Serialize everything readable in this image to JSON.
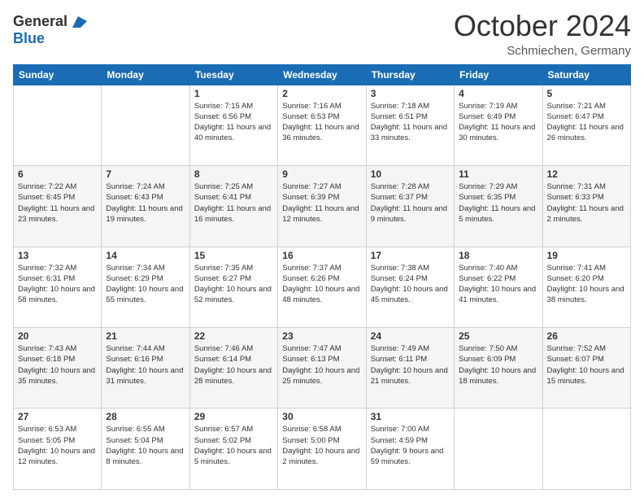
{
  "header": {
    "logo_general": "General",
    "logo_blue": "Blue",
    "month_title": "October 2024",
    "location": "Schmiechen, Germany"
  },
  "weekdays": [
    "Sunday",
    "Monday",
    "Tuesday",
    "Wednesday",
    "Thursday",
    "Friday",
    "Saturday"
  ],
  "weeks": [
    [
      {
        "day": "",
        "info": ""
      },
      {
        "day": "",
        "info": ""
      },
      {
        "day": "1",
        "info": "Sunrise: 7:15 AM\nSunset: 6:56 PM\nDaylight: 11 hours and 40 minutes."
      },
      {
        "day": "2",
        "info": "Sunrise: 7:16 AM\nSunset: 6:53 PM\nDaylight: 11 hours and 36 minutes."
      },
      {
        "day": "3",
        "info": "Sunrise: 7:18 AM\nSunset: 6:51 PM\nDaylight: 11 hours and 33 minutes."
      },
      {
        "day": "4",
        "info": "Sunrise: 7:19 AM\nSunset: 6:49 PM\nDaylight: 11 hours and 30 minutes."
      },
      {
        "day": "5",
        "info": "Sunrise: 7:21 AM\nSunset: 6:47 PM\nDaylight: 11 hours and 26 minutes."
      }
    ],
    [
      {
        "day": "6",
        "info": "Sunrise: 7:22 AM\nSunset: 6:45 PM\nDaylight: 11 hours and 23 minutes."
      },
      {
        "day": "7",
        "info": "Sunrise: 7:24 AM\nSunset: 6:43 PM\nDaylight: 11 hours and 19 minutes."
      },
      {
        "day": "8",
        "info": "Sunrise: 7:25 AM\nSunset: 6:41 PM\nDaylight: 11 hours and 16 minutes."
      },
      {
        "day": "9",
        "info": "Sunrise: 7:27 AM\nSunset: 6:39 PM\nDaylight: 11 hours and 12 minutes."
      },
      {
        "day": "10",
        "info": "Sunrise: 7:28 AM\nSunset: 6:37 PM\nDaylight: 11 hours and 9 minutes."
      },
      {
        "day": "11",
        "info": "Sunrise: 7:29 AM\nSunset: 6:35 PM\nDaylight: 11 hours and 5 minutes."
      },
      {
        "day": "12",
        "info": "Sunrise: 7:31 AM\nSunset: 6:33 PM\nDaylight: 11 hours and 2 minutes."
      }
    ],
    [
      {
        "day": "13",
        "info": "Sunrise: 7:32 AM\nSunset: 6:31 PM\nDaylight: 10 hours and 58 minutes."
      },
      {
        "day": "14",
        "info": "Sunrise: 7:34 AM\nSunset: 6:29 PM\nDaylight: 10 hours and 55 minutes."
      },
      {
        "day": "15",
        "info": "Sunrise: 7:35 AM\nSunset: 6:27 PM\nDaylight: 10 hours and 52 minutes."
      },
      {
        "day": "16",
        "info": "Sunrise: 7:37 AM\nSunset: 6:26 PM\nDaylight: 10 hours and 48 minutes."
      },
      {
        "day": "17",
        "info": "Sunrise: 7:38 AM\nSunset: 6:24 PM\nDaylight: 10 hours and 45 minutes."
      },
      {
        "day": "18",
        "info": "Sunrise: 7:40 AM\nSunset: 6:22 PM\nDaylight: 10 hours and 41 minutes."
      },
      {
        "day": "19",
        "info": "Sunrise: 7:41 AM\nSunset: 6:20 PM\nDaylight: 10 hours and 38 minutes."
      }
    ],
    [
      {
        "day": "20",
        "info": "Sunrise: 7:43 AM\nSunset: 6:18 PM\nDaylight: 10 hours and 35 minutes."
      },
      {
        "day": "21",
        "info": "Sunrise: 7:44 AM\nSunset: 6:16 PM\nDaylight: 10 hours and 31 minutes."
      },
      {
        "day": "22",
        "info": "Sunrise: 7:46 AM\nSunset: 6:14 PM\nDaylight: 10 hours and 28 minutes."
      },
      {
        "day": "23",
        "info": "Sunrise: 7:47 AM\nSunset: 6:13 PM\nDaylight: 10 hours and 25 minutes."
      },
      {
        "day": "24",
        "info": "Sunrise: 7:49 AM\nSunset: 6:11 PM\nDaylight: 10 hours and 21 minutes."
      },
      {
        "day": "25",
        "info": "Sunrise: 7:50 AM\nSunset: 6:09 PM\nDaylight: 10 hours and 18 minutes."
      },
      {
        "day": "26",
        "info": "Sunrise: 7:52 AM\nSunset: 6:07 PM\nDaylight: 10 hours and 15 minutes."
      }
    ],
    [
      {
        "day": "27",
        "info": "Sunrise: 6:53 AM\nSunset: 5:05 PM\nDaylight: 10 hours and 12 minutes."
      },
      {
        "day": "28",
        "info": "Sunrise: 6:55 AM\nSunset: 5:04 PM\nDaylight: 10 hours and 8 minutes."
      },
      {
        "day": "29",
        "info": "Sunrise: 6:57 AM\nSunset: 5:02 PM\nDaylight: 10 hours and 5 minutes."
      },
      {
        "day": "30",
        "info": "Sunrise: 6:58 AM\nSunset: 5:00 PM\nDaylight: 10 hours and 2 minutes."
      },
      {
        "day": "31",
        "info": "Sunrise: 7:00 AM\nSunset: 4:59 PM\nDaylight: 9 hours and 59 minutes."
      },
      {
        "day": "",
        "info": ""
      },
      {
        "day": "",
        "info": ""
      }
    ]
  ]
}
